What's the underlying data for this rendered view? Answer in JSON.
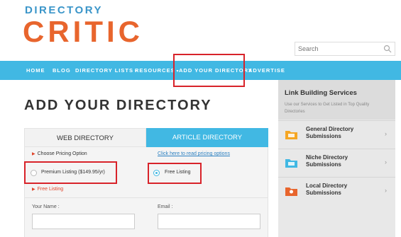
{
  "header": {
    "logo_top": "DIRECTORY",
    "logo_main": "CRITIC",
    "search_placeholder": "Search"
  },
  "nav": {
    "items": [
      {
        "label": "HOME"
      },
      {
        "label": "BLOG"
      },
      {
        "label": "DIRECTORY LISTS"
      },
      {
        "label": "RESOURCES"
      },
      {
        "label": "ADD YOUR DIRECTORY"
      },
      {
        "label": "ADVERTISE"
      }
    ]
  },
  "main": {
    "title": "ADD YOUR DIRECTORY",
    "tabs": [
      {
        "label": "WEB DIRECTORY",
        "active": false
      },
      {
        "label": "ARTICLE DIRECTORY",
        "active": true
      }
    ],
    "choose_label": "Choose Pricing Option",
    "read_link": "Click here to read pricing options",
    "options": [
      {
        "label": "Premium Listing ($149.95/yr)",
        "selected": false
      },
      {
        "label": "Free Listing",
        "selected": true
      }
    ],
    "selected_note": "Free Listing",
    "fields": [
      {
        "label": "Your Name :",
        "value": ""
      },
      {
        "label": "Email :",
        "value": ""
      }
    ]
  },
  "sidebar": {
    "title": "Link Building Services",
    "description": "Use our Services to Get Listed in Top Quality Directories",
    "items": [
      {
        "label": "General Directory Submissions",
        "icon": "folder-icon",
        "color": "#f5a623"
      },
      {
        "label": "Niche Directory Submissions",
        "icon": "folder-icon",
        "color": "#41b8e3"
      },
      {
        "label": "Local Directory Submissions",
        "icon": "map-pin-folder-icon",
        "color": "#e8652d"
      }
    ]
  },
  "colors": {
    "accent": "#41b8e3",
    "brand_orange": "#e8652d",
    "highlight": "#d8232a"
  }
}
